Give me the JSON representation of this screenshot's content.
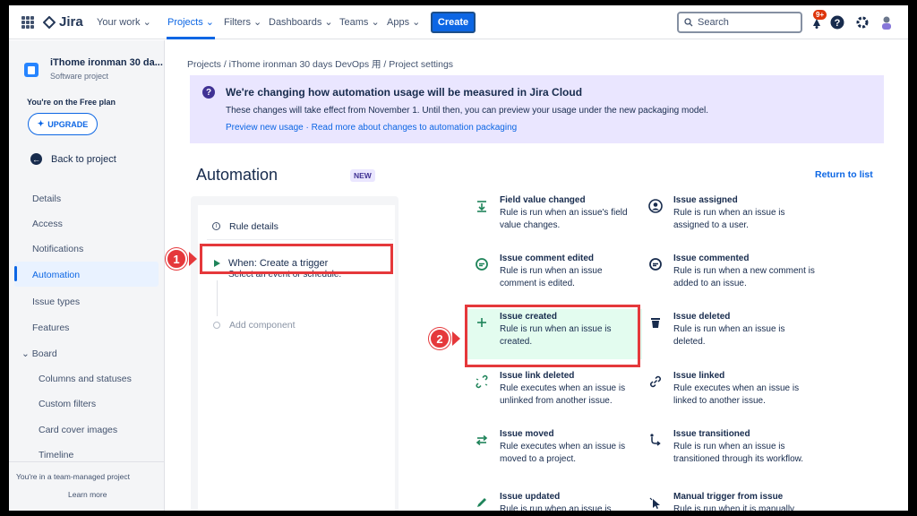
{
  "topnav": {
    "logo": "Jira",
    "items": [
      "Your work",
      "Projects",
      "Filters",
      "Dashboards",
      "Teams",
      "Apps"
    ],
    "create_label": "Create",
    "search_placeholder": "Search",
    "notif_badge": "9+"
  },
  "sidebar": {
    "project_name": "iThome ironman 30 da...",
    "project_type": "Software project",
    "free_plan": "You're on the Free plan",
    "upgrade_label": "UPGRADE",
    "back_label": "Back to project",
    "items": [
      "Details",
      "Access",
      "Notifications",
      "Automation",
      "Issue types",
      "Features",
      "Board"
    ],
    "board_items": [
      "Columns and statuses",
      "Custom filters",
      "Card cover images",
      "Timeline"
    ],
    "team_note": "You're in a team-managed project",
    "learn_more": "Learn more"
  },
  "breadcrumb": "Projects / iThome ironman 30 days DevOps 用 / Project settings",
  "banner": {
    "title": "We're changing how automation usage will be measured in Jira Cloud",
    "body": "These changes will take effect from November 1. Until then, you can preview your usage under the new packaging model.",
    "links": "Preview new usage · Read more about changes to automation packaging"
  },
  "automation": {
    "heading": "Automation",
    "new_badge": "NEW",
    "return_link": "Return to list",
    "rule_details": "Rule details",
    "trigger_title": "When: Create a trigger",
    "trigger_sub": "Select an event or schedule.",
    "add_component": "Add component"
  },
  "callouts": [
    "1",
    "2"
  ],
  "triggers": [
    {
      "title": "Field value changed",
      "desc": "Rule is run when an issue's field value changes.",
      "icon": "field-value-icon"
    },
    {
      "title": "Issue assigned",
      "desc": "Rule is run when an issue is assigned to a user.",
      "icon": "user-icon"
    },
    {
      "title": "Issue comment edited",
      "desc": "Rule is run when an issue comment is edited.",
      "icon": "comment-icon"
    },
    {
      "title": "Issue commented",
      "desc": "Rule is run when a new comment is added to an issue.",
      "icon": "comment-icon"
    },
    {
      "title": "Issue created",
      "desc": "Rule is run when an issue is created.",
      "icon": "plus-icon"
    },
    {
      "title": "Issue deleted",
      "desc": "Rule is run when an issue is deleted.",
      "icon": "trash-icon"
    },
    {
      "title": "Issue link deleted",
      "desc": "Rule executes when an issue is unlinked from another issue.",
      "icon": "unlink-icon"
    },
    {
      "title": "Issue linked",
      "desc": "Rule executes when an issue is linked to another issue.",
      "icon": "link-icon"
    },
    {
      "title": "Issue moved",
      "desc": "Rule executes when an issue is moved to a project.",
      "icon": "move-icon"
    },
    {
      "title": "Issue transitioned",
      "desc": "Rule is run when an issue is transitioned through its workflow.",
      "icon": "transition-icon"
    },
    {
      "title": "Issue updated",
      "desc": "Rule is run when an issue is",
      "icon": "pencil-icon"
    },
    {
      "title": "Manual trigger from issue",
      "desc": "Rule is run when it is manually",
      "icon": "cursor-icon"
    }
  ]
}
